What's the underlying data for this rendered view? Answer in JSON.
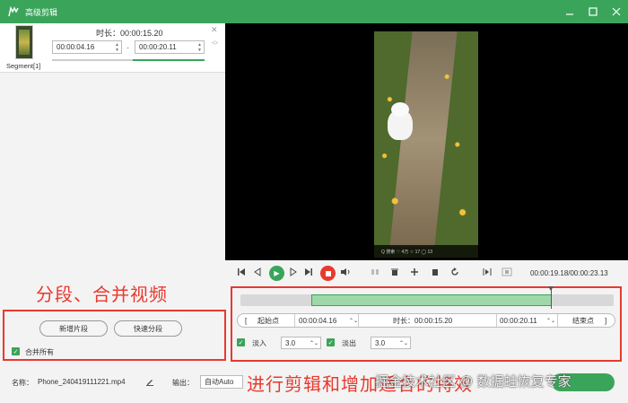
{
  "window": {
    "title": "高级剪辑",
    "controls": [
      "minimize-icon",
      "maximize-icon",
      "close-icon"
    ]
  },
  "segment": {
    "label": "Segment[1]",
    "duration": "时长：00:00:15.20",
    "start": "00:00:04.16",
    "separator": "-",
    "end": "00:00:20.11"
  },
  "annotations": {
    "split_merge": "分段、合并视频",
    "edit_effects": "进行剪辑和增加适合的特效"
  },
  "buttons": {
    "new_segment": "新增片段",
    "quick_split": "快速分段",
    "merge_all": "合并所有"
  },
  "player": {
    "time_readout": "00:00:19.18/00:00:23.13",
    "video_bar": "Q 搜索  ♡ 4万  ☆ 17  ◯ 13"
  },
  "range": {
    "start_btn": "起始点",
    "start_val": "00:00:04.16",
    "duration": "时长：00:00:15.20",
    "end_val": "00:00:20.11",
    "end_btn": "结束点"
  },
  "fade": {
    "in_label": "淡入",
    "in_val": "3.0",
    "out_label": "淡出",
    "out_val": "3.0"
  },
  "footer": {
    "name_label": "名称：",
    "filename": "Phone_240419111221.mp4",
    "output_label": "输出：",
    "output_val": "自动Auto"
  },
  "watermark": "掘金技术社区 @ 数据蛙恢复专家",
  "colors": {
    "brand_green": "#3aa55a",
    "accent_red": "#e8392e"
  }
}
